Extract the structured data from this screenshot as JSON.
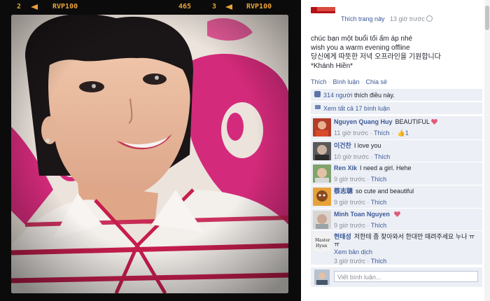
{
  "film_strip": {
    "frame_left": "2",
    "label_left": "RVP100",
    "counter": "465",
    "frame_right": "3",
    "label_right": "RVP100",
    "color": "#e8a13a"
  },
  "post": {
    "like_page": "Thích trang này",
    "time": "13 giờ trước",
    "status_lines": [
      "chúc bạn một buổi tối ấm áp nhé",
      "wish you a warm evening offline",
      "당신에게 따뜻한 저녁 오프라인을 기원합니다",
      "*Khánh Hiền*"
    ],
    "actions": {
      "like": "Thích",
      "comment": "Bình luận",
      "share": "Chia sẻ"
    },
    "likes": {
      "count": "314 người",
      "suffix": "thích điều này."
    },
    "view_comments": "Xem tất cả 17 bình luận"
  },
  "comments": [
    {
      "name": "Nguyen Quang Huy",
      "text": "BEAUTIFUL",
      "heart": true,
      "time": "11 giờ trước",
      "like": "Thích",
      "like_count": "1"
    },
    {
      "name": "이건찬",
      "text": "I love you",
      "time": "10 giờ trước",
      "like": "Thích"
    },
    {
      "name": "Ren Xik",
      "text": "I need a girl. Hehe",
      "time": "9 giờ trước",
      "like": "Thích"
    },
    {
      "name": "蔡志聰",
      "text": "so cute and beautiful",
      "time": "9 giờ trước",
      "like": "Thích"
    },
    {
      "name": "Minh Toan Nguyen",
      "text": "",
      "heart": true,
      "time": "9 giờ trước",
      "like": "Thích"
    },
    {
      "name": "현태성",
      "text": "저한테 좀 찾아와서 한대만 때려주세요 누나 ㅠㅠ",
      "see_translation": "Xem bản dịch",
      "time": "3 giờ trước",
      "like": "Thích"
    }
  ],
  "write_comment": {
    "placeholder": "Viết bình luận..."
  },
  "colors": {
    "link": "#3b5998",
    "panel": "#eceff5",
    "heart": "#e05a7a"
  }
}
